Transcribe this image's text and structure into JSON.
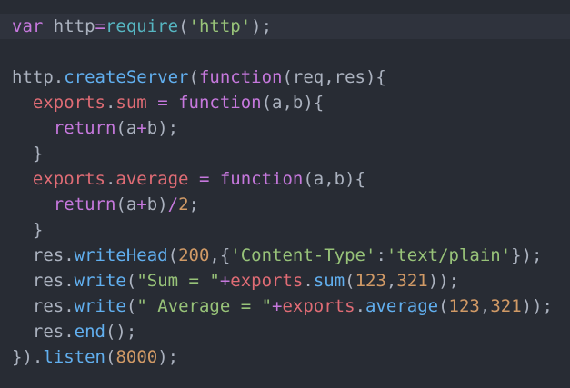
{
  "editor": {
    "language": "javascript",
    "theme": {
      "background": "#282c34",
      "current_line_background": "#2f333d"
    },
    "lines": [
      {
        "current": true,
        "tokens": [
          {
            "t": "var",
            "c": "#c678dd"
          },
          {
            "t": " http",
            "c": "#abb2bf"
          },
          {
            "t": "=",
            "c": "#c678dd"
          },
          {
            "t": "require",
            "c": "#56b6c2"
          },
          {
            "t": "(",
            "c": "#abb2bf"
          },
          {
            "t": "'http'",
            "c": "#98c379"
          },
          {
            "t": ");",
            "c": "#abb2bf"
          }
        ]
      },
      {
        "tokens": []
      },
      {
        "tokens": [
          {
            "t": "http",
            "c": "#abb2bf"
          },
          {
            "t": ".",
            "c": "#abb2bf"
          },
          {
            "t": "createServer",
            "c": "#61afef"
          },
          {
            "t": "(",
            "c": "#abb2bf"
          },
          {
            "t": "function",
            "c": "#c678dd"
          },
          {
            "t": "(req,res){",
            "c": "#abb2bf"
          }
        ]
      },
      {
        "tokens": [
          {
            "t": "  ",
            "c": "#abb2bf"
          },
          {
            "t": "exports",
            "c": "#e06c75"
          },
          {
            "t": ".",
            "c": "#abb2bf"
          },
          {
            "t": "sum",
            "c": "#e06c75"
          },
          {
            "t": " = ",
            "c": "#c678dd"
          },
          {
            "t": "function",
            "c": "#c678dd"
          },
          {
            "t": "(a,b){",
            "c": "#abb2bf"
          }
        ]
      },
      {
        "tokens": [
          {
            "t": "    ",
            "c": "#abb2bf"
          },
          {
            "t": "return",
            "c": "#c678dd"
          },
          {
            "t": "(a",
            "c": "#abb2bf"
          },
          {
            "t": "+",
            "c": "#c678dd"
          },
          {
            "t": "b);",
            "c": "#abb2bf"
          }
        ]
      },
      {
        "tokens": [
          {
            "t": "  }",
            "c": "#abb2bf"
          }
        ]
      },
      {
        "tokens": [
          {
            "t": "  ",
            "c": "#abb2bf"
          },
          {
            "t": "exports",
            "c": "#e06c75"
          },
          {
            "t": ".",
            "c": "#abb2bf"
          },
          {
            "t": "average",
            "c": "#e06c75"
          },
          {
            "t": " = ",
            "c": "#c678dd"
          },
          {
            "t": "function",
            "c": "#c678dd"
          },
          {
            "t": "(a,b){",
            "c": "#abb2bf"
          }
        ]
      },
      {
        "tokens": [
          {
            "t": "    ",
            "c": "#abb2bf"
          },
          {
            "t": "return",
            "c": "#c678dd"
          },
          {
            "t": "(a",
            "c": "#abb2bf"
          },
          {
            "t": "+",
            "c": "#c678dd"
          },
          {
            "t": "b)",
            "c": "#abb2bf"
          },
          {
            "t": "/",
            "c": "#c678dd"
          },
          {
            "t": "2",
            "c": "#d19a66"
          },
          {
            "t": ";",
            "c": "#abb2bf"
          }
        ]
      },
      {
        "tokens": [
          {
            "t": "  }",
            "c": "#abb2bf"
          }
        ]
      },
      {
        "tokens": [
          {
            "t": "  res",
            "c": "#abb2bf"
          },
          {
            "t": ".",
            "c": "#abb2bf"
          },
          {
            "t": "writeHead",
            "c": "#61afef"
          },
          {
            "t": "(",
            "c": "#abb2bf"
          },
          {
            "t": "200",
            "c": "#d19a66"
          },
          {
            "t": ",{",
            "c": "#abb2bf"
          },
          {
            "t": "'Content-Type'",
            "c": "#98c379"
          },
          {
            "t": ":",
            "c": "#abb2bf"
          },
          {
            "t": "'text/plain'",
            "c": "#98c379"
          },
          {
            "t": "});",
            "c": "#abb2bf"
          }
        ]
      },
      {
        "tokens": [
          {
            "t": "  res",
            "c": "#abb2bf"
          },
          {
            "t": ".",
            "c": "#abb2bf"
          },
          {
            "t": "write",
            "c": "#61afef"
          },
          {
            "t": "(",
            "c": "#abb2bf"
          },
          {
            "t": "\"Sum = \"",
            "c": "#98c379"
          },
          {
            "t": "+",
            "c": "#c678dd"
          },
          {
            "t": "exports",
            "c": "#e06c75"
          },
          {
            "t": ".",
            "c": "#abb2bf"
          },
          {
            "t": "sum",
            "c": "#61afef"
          },
          {
            "t": "(",
            "c": "#abb2bf"
          },
          {
            "t": "123",
            "c": "#d19a66"
          },
          {
            "t": ",",
            "c": "#abb2bf"
          },
          {
            "t": "321",
            "c": "#d19a66"
          },
          {
            "t": "));",
            "c": "#abb2bf"
          }
        ]
      },
      {
        "tokens": [
          {
            "t": "  res",
            "c": "#abb2bf"
          },
          {
            "t": ".",
            "c": "#abb2bf"
          },
          {
            "t": "write",
            "c": "#61afef"
          },
          {
            "t": "(",
            "c": "#abb2bf"
          },
          {
            "t": "\" Average = \"",
            "c": "#98c379"
          },
          {
            "t": "+",
            "c": "#c678dd"
          },
          {
            "t": "exports",
            "c": "#e06c75"
          },
          {
            "t": ".",
            "c": "#abb2bf"
          },
          {
            "t": "average",
            "c": "#61afef"
          },
          {
            "t": "(",
            "c": "#abb2bf"
          },
          {
            "t": "123",
            "c": "#d19a66"
          },
          {
            "t": ",",
            "c": "#abb2bf"
          },
          {
            "t": "321",
            "c": "#d19a66"
          },
          {
            "t": "));",
            "c": "#abb2bf"
          }
        ]
      },
      {
        "tokens": [
          {
            "t": "  res",
            "c": "#abb2bf"
          },
          {
            "t": ".",
            "c": "#abb2bf"
          },
          {
            "t": "end",
            "c": "#61afef"
          },
          {
            "t": "();",
            "c": "#abb2bf"
          }
        ]
      },
      {
        "tokens": [
          {
            "t": "})",
            "c": "#abb2bf"
          },
          {
            "t": ".",
            "c": "#abb2bf"
          },
          {
            "t": "listen",
            "c": "#61afef"
          },
          {
            "t": "(",
            "c": "#abb2bf"
          },
          {
            "t": "8000",
            "c": "#d19a66"
          },
          {
            "t": ");",
            "c": "#abb2bf"
          }
        ]
      }
    ]
  }
}
